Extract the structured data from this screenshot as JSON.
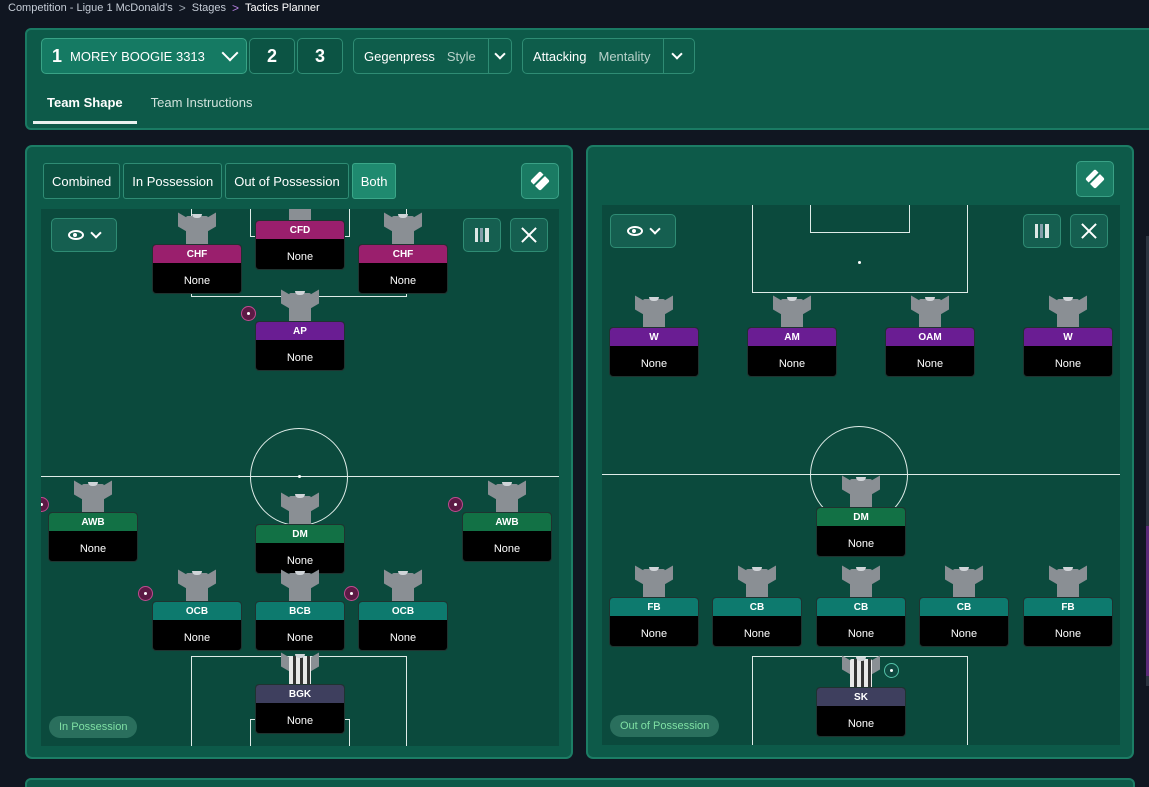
{
  "breadcrumb": {
    "item1": "Competition - Ligue 1 McDonald's",
    "item2": "Stages",
    "current": "Tactics Planner",
    "sep": ">"
  },
  "tactic_bar": {
    "tactic_number": "1",
    "tactic_name": "MOREY BOOGIE 3313",
    "slot2": "2",
    "slot3": "3",
    "style_value": "Gegenpress",
    "style_label": "Style",
    "mentality_value": "Attacking",
    "mentality_label": "Mentality"
  },
  "tabs": {
    "team_shape": "Team Shape",
    "team_instructions": "Team Instructions"
  },
  "filters": {
    "combined": "Combined",
    "in_possession": "In Possession",
    "out_of_possession": "Out of Possession",
    "both": "Both"
  },
  "left_pitch": {
    "phase_label": "In Possession",
    "players": [
      {
        "role": "CFD",
        "duty": "None",
        "kind": "fwd",
        "badge": false
      },
      {
        "role": "CHF",
        "duty": "None",
        "kind": "fwd",
        "badge": false
      },
      {
        "role": "CHF",
        "duty": "None",
        "kind": "fwd",
        "badge": false
      },
      {
        "role": "AP",
        "duty": "None",
        "kind": "mid",
        "badge": true
      },
      {
        "role": "AWB",
        "duty": "None",
        "kind": "def",
        "badge": true
      },
      {
        "role": "DM",
        "duty": "None",
        "kind": "def",
        "badge": false
      },
      {
        "role": "AWB",
        "duty": "None",
        "kind": "def",
        "badge": true
      },
      {
        "role": "OCB",
        "duty": "None",
        "kind": "back",
        "badge": true
      },
      {
        "role": "BCB",
        "duty": "None",
        "kind": "back",
        "badge": false
      },
      {
        "role": "OCB",
        "duty": "None",
        "kind": "back",
        "badge": true
      },
      {
        "role": "BGK",
        "duty": "None",
        "kind": "gk",
        "badge": false
      }
    ]
  },
  "right_pitch": {
    "phase_label": "Out of Possession",
    "players": [
      {
        "role": "W",
        "duty": "None",
        "kind": "mid",
        "badge": false
      },
      {
        "role": "AM",
        "duty": "None",
        "kind": "mid",
        "badge": false
      },
      {
        "role": "OAM",
        "duty": "None",
        "kind": "mid",
        "badge": false
      },
      {
        "role": "W",
        "duty": "None",
        "kind": "mid",
        "badge": false
      },
      {
        "role": "DM",
        "duty": "None",
        "kind": "def",
        "badge": false
      },
      {
        "role": "FB",
        "duty": "None",
        "kind": "back",
        "badge": false
      },
      {
        "role": "CB",
        "duty": "None",
        "kind": "back",
        "badge": false
      },
      {
        "role": "CB",
        "duty": "None",
        "kind": "back",
        "badge": false
      },
      {
        "role": "CB",
        "duty": "None",
        "kind": "back",
        "badge": false
      },
      {
        "role": "FB",
        "duty": "None",
        "kind": "back",
        "badge": false
      },
      {
        "role": "SK",
        "duty": "None",
        "kind": "gk",
        "badge": true
      }
    ]
  },
  "icons": {
    "dropdown": "chevron-down-icon",
    "kit": "kit-icon",
    "view": "eye-icon",
    "grid": "grid-icon",
    "expand": "expand-icon"
  },
  "colors": {
    "panel_bg": "#0d5a49",
    "pitch_bg": "#0b4a3d",
    "role_forward": "#9a1f6d",
    "role_midfield": "#6a1d93",
    "role_defensive_mid": "#127145",
    "role_back": "#0d7a6e",
    "role_keeper": "#3e3f5e"
  }
}
